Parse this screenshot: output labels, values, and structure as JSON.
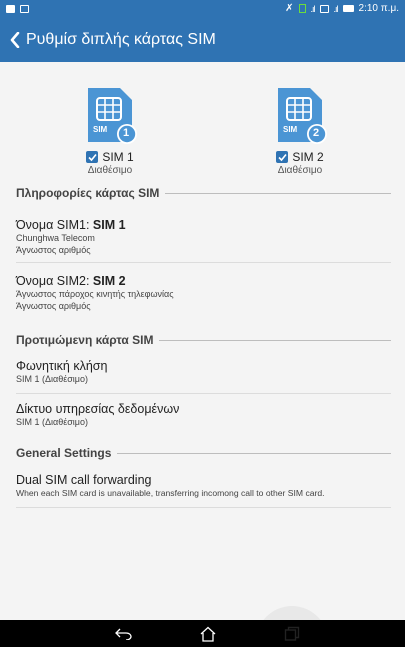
{
  "status_bar": {
    "time": "2:10 π.μ."
  },
  "app_bar": {
    "title": "Ρυθμίσ διπλής κάρτας SIM"
  },
  "sim_cards": [
    {
      "badge": "1",
      "icon_label": "SIM",
      "name": "SIM 1",
      "status": "Διαθέσιμο",
      "checked": true
    },
    {
      "badge": "2",
      "icon_label": "SIM",
      "name": "SIM 2",
      "status": "Διαθέσιμο",
      "checked": true
    }
  ],
  "sections": {
    "sim_info": "Πληροφορίες κάρτας SIM",
    "preferred": "Προτιμώμενη κάρτα SIM",
    "general": "General Settings"
  },
  "sim1_row": {
    "label": "Όνομα SIM1: ",
    "value": "SIM 1",
    "line1": "Chunghwa Telecom",
    "line2": "Άγνωστος αριθμός"
  },
  "sim2_row": {
    "label": "Όνομα SIM2: ",
    "value": "SIM 2",
    "line1": "Άγνωστος πάροχος κινητής τηλεφωνίας",
    "line2": "Άγνωστος αριθμός"
  },
  "voice_call": {
    "title": "Φωνητική κλήση",
    "value": "SIM 1 (Διαθέσιμο)"
  },
  "data_network": {
    "title": "Δίκτυο υπηρεσίας δεδομένων",
    "value": "SIM 1 (Διαθέσιμο)"
  },
  "call_forwarding": {
    "title": "Dual SIM call forwarding",
    "description": "When each SIM card is unavailable, transferring incomong call to other SIM card."
  },
  "colors": {
    "accent": "#2f73b3",
    "sim_icon": "#4b95d4"
  },
  "nav": {
    "icons": [
      "back-icon",
      "home-icon",
      "recents-icon"
    ]
  }
}
